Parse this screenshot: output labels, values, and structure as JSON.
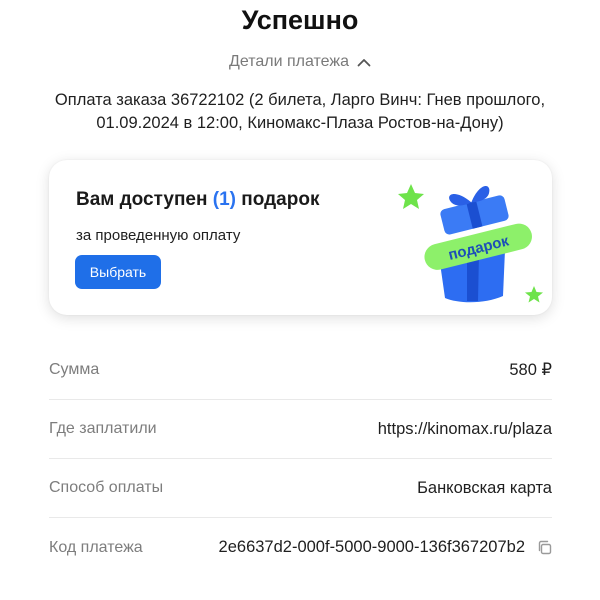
{
  "header": {
    "title": "Успешно",
    "details_toggle_label": "Детали платежа"
  },
  "payment": {
    "description_line1": "Оплата заказа 36722102 (2 билета, Ларго Винч: Гнев прошлого,",
    "description_line2": "01.09.2024 в 12:00, Киномакс-Плаза Ростов-на-Дону)"
  },
  "gift_card": {
    "title_prefix": "Вам доступен",
    "count": "(1)",
    "title_suffix": "подарок",
    "subtitle": "за проведенную оплату",
    "button_label": "Выбрать",
    "ribbon_text": "подарок",
    "accent_color": "#2a73f0",
    "button_color": "#1f6fe8",
    "star_color": "#6ee34a",
    "box_color": "#2d6df2"
  },
  "details": [
    {
      "label": "Сумма",
      "value": "580 ₽"
    },
    {
      "label": "Где заплатили",
      "value": "https://kinomax.ru/plaza"
    },
    {
      "label": "Способ оплаты",
      "value": "Банковская карта"
    },
    {
      "label": "Код платежа",
      "value": "2e6637d2-000f-5000-9000-136f367207b2",
      "icon": "copy-icon"
    }
  ]
}
